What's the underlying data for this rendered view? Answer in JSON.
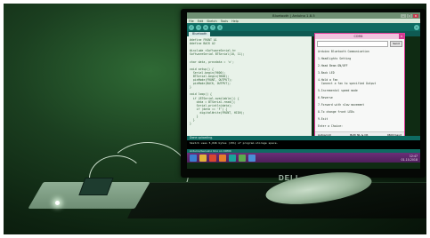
{
  "ide": {
    "window_title": "Bluetooth | Arduino 1.8.5",
    "menu": [
      "File",
      "Edit",
      "Sketch",
      "Tools",
      "Help"
    ],
    "tab_name": "Bluetooth",
    "code_lines": [
      "#define FRONT A1",
      "#define BACK A2",
      "",
      "#include <SoftwareSerial.h>",
      "SoftwareSerial BTSerial(10, 11);",
      "",
      "char data, prevdata = 'x';",
      "",
      "void setup() {",
      "  Serial.begin(9600);",
      "  BTSerial.begin(9600);",
      "  pinMode(FRONT, OUTPUT);",
      "  pinMode(BACK, OUTPUT);",
      "}",
      "",
      "void loop() {",
      "  if (BTSerial.available()) {",
      "    data = BTSerial.read();",
      "    Serial.println(data);",
      "    if (data == 'F') {",
      "      digitalWrite(FRONT, HIGH);",
      "    }",
      "  }",
      "}"
    ],
    "console_bar": "Done uploading.",
    "console_text": "Sketch uses 5,046 bytes (15%) of program storage space.",
    "status_line": "Arduino/Genuino Uno on COM4"
  },
  "serial_monitor": {
    "title": "COM4",
    "send_label": "Send",
    "lines": [
      "Arduino Bluetooth Communication",
      "",
      "1.Headlights Setting",
      "",
      "2.Head Beam ON/OFF",
      "",
      "3.Back LED",
      "",
      "4.Hold a Fan",
      "  Connect a fan to specified Output",
      "",
      "5.Incremental speed mode",
      "",
      "6.Reverse",
      "",
      "7.Forward with slow movement",
      "",
      "8.To change front LEDs",
      "",
      "9.Exit",
      "",
      "Enter a Choice:"
    ],
    "autoscroll_label": "Autoscroll",
    "line_ending": "Both NL & CR",
    "baud": "9600 baud"
  },
  "taskbar": {
    "clock_time": "12:47",
    "clock_date": "01-10-2018"
  },
  "laptop_brand": "DELL",
  "colors": {
    "ambient": "#2f6a35",
    "ide_teal": "#0f6b62",
    "serial_border": "#e23c9a",
    "taskbar": "#6b2f77"
  }
}
